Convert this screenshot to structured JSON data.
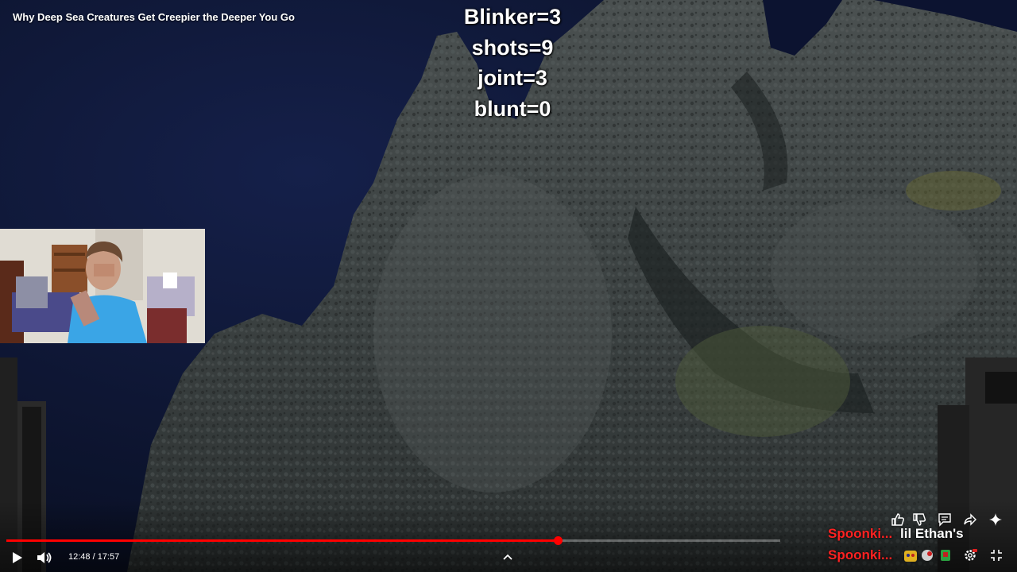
{
  "video": {
    "title": "Why Deep Sea Creatures Get Creepier the Deeper You Go"
  },
  "overlay_counter": {
    "lines": [
      "Blinker=3",
      "shots=9",
      "joint=3",
      "blunt=0"
    ]
  },
  "player": {
    "time_display": "12:48 / 17:57",
    "progress_fraction": 0.713,
    "progress_color": "#ff0000"
  },
  "chat_labels": {
    "name1": "Spoonki...",
    "name2": "lil Ethan's",
    "name3": "Spoonki...",
    "name_color": "#ff2222",
    "name2_color": "#ffffff"
  },
  "icons": {
    "play": "play-icon",
    "volume": "volume-icon",
    "chevron": "chevron-up-icon",
    "like": "thumbs-up-icon",
    "dislike": "thumbs-down-icon",
    "comments": "comment-icon",
    "share": "share-icon",
    "sparkle": "sparkle-icon",
    "settings": "gear-icon",
    "exit_fullscreen": "exit-fullscreen-icon"
  }
}
